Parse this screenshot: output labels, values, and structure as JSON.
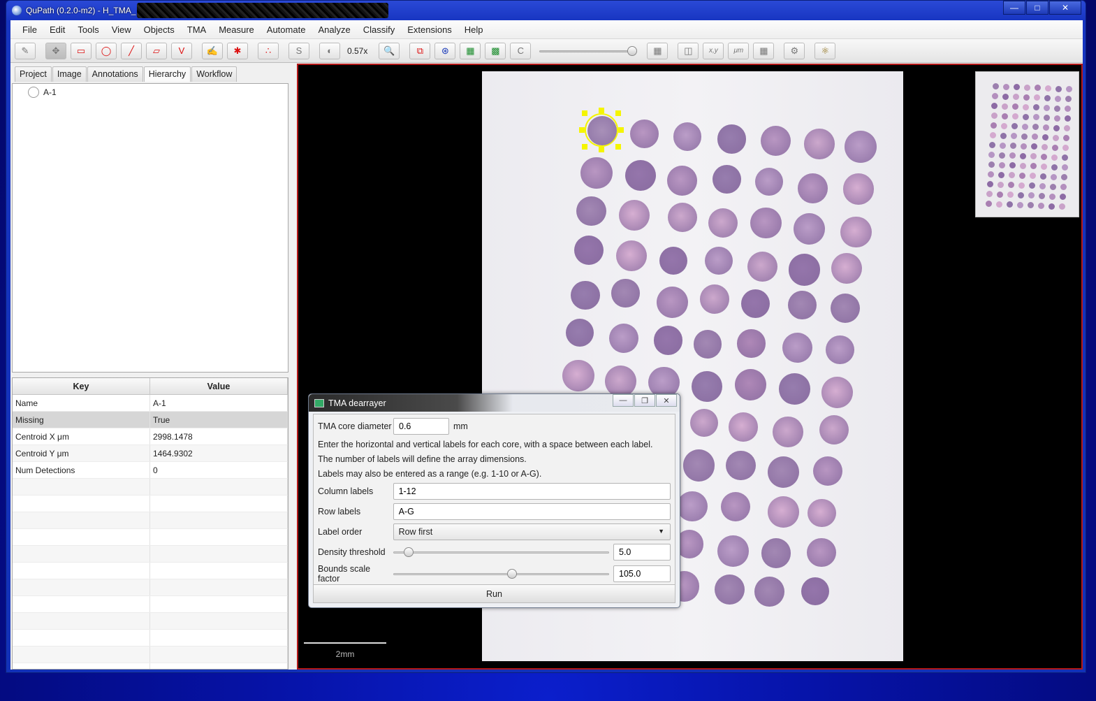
{
  "window": {
    "title": "QuPath (0.2.0-m2) - H_TMA_",
    "minimize_icon": "minimize-icon",
    "maximize_icon": "maximize-icon",
    "close_icon": "close-icon"
  },
  "menu": [
    "File",
    "Edit",
    "Tools",
    "View",
    "Objects",
    "TMA",
    "Measure",
    "Automate",
    "Analyze",
    "Classify",
    "Extensions",
    "Help"
  ],
  "toolbar": {
    "zoom": "0.57x",
    "s_label": "S",
    "c_label": "C",
    "xy_label": "x,y",
    "um_label": "μm"
  },
  "left_tabs": [
    "Project",
    "Image",
    "Annotations",
    "Hierarchy",
    "Workflow"
  ],
  "hierarchy": {
    "items": [
      "A-1"
    ]
  },
  "properties": {
    "headers": {
      "key": "Key",
      "value": "Value"
    },
    "rows": [
      {
        "key": "Name",
        "value": "A-1"
      },
      {
        "key": "Missing",
        "value": "True"
      },
      {
        "key": "Centroid X μm",
        "value": "2998.1478"
      },
      {
        "key": "Centroid Y μm",
        "value": "1464.9302"
      },
      {
        "key": "Num Detections",
        "value": "0"
      }
    ]
  },
  "viewer": {
    "scalebar_label": "2mm"
  },
  "dialog": {
    "title": "TMA dearrayer",
    "core_diameter_label": "TMA core diameter",
    "core_diameter_value": "0.6",
    "core_diameter_unit": "mm",
    "info_line1": "Enter the horizontal and vertical labels for each core, with a space between each label.",
    "info_line2": "The number of labels will define the array dimensions.",
    "info_line3": "Labels may also be entered as a range (e.g. 1-10 or A-G).",
    "column_labels_label": "Column labels",
    "column_labels_value": "1-12",
    "row_labels_label": "Row labels",
    "row_labels_value": "A-G",
    "label_order_label": "Label order",
    "label_order_value": "Row first",
    "density_label": "Density threshold",
    "density_value": "5.0",
    "density_level": 0.05,
    "bounds_label": "Bounds scale factor",
    "bounds_value": "105.0",
    "bounds_level": 0.55,
    "run_label": "Run"
  }
}
